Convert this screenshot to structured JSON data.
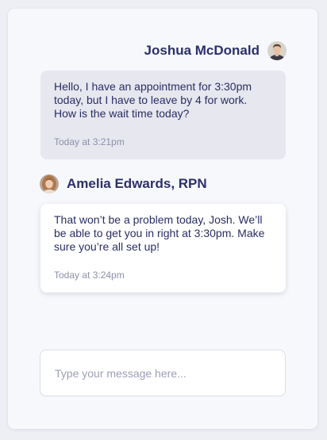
{
  "conversation": {
    "messages": [
      {
        "sender": "Joshua McDonald",
        "avatar_icon": "joshua-avatar",
        "text": "Hello, I have an appointment for 3:30pm today, but I have to leave by 4 for work. How is the wait time today?",
        "time": "Today at 3:21pm"
      },
      {
        "sender": "Amelia Edwards, RPN",
        "avatar_icon": "amelia-avatar",
        "text": "That won’t be a problem today, Josh. We’ll be able to get you in right at 3:30pm. Make sure you’re all set up!",
        "time": "Today at 3:24pm"
      }
    ]
  },
  "composer": {
    "placeholder": "Type your message here...",
    "value": ""
  },
  "colors": {
    "name": "#2c2f6b",
    "incoming_bubble": "#e6e7ef",
    "outgoing_bubble": "#ffffff",
    "timestamp": "#8d90aa"
  }
}
